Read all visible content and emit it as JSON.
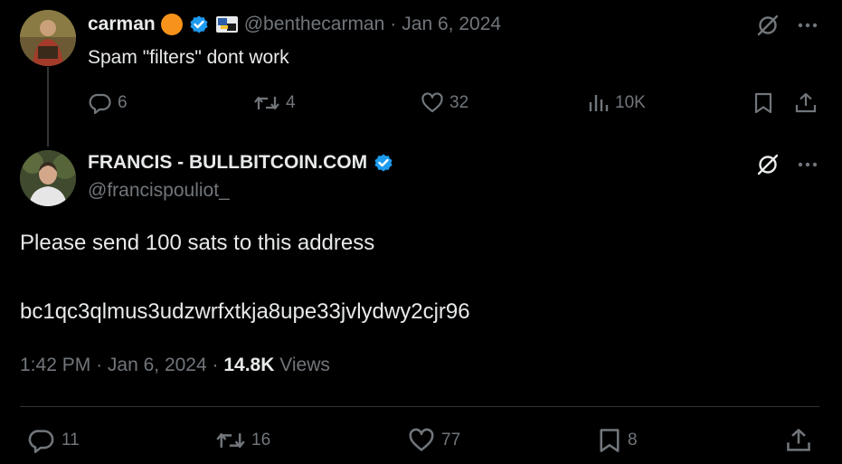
{
  "parent_tweet": {
    "display_name": "carman",
    "handle": "@benthecarman",
    "separator": "·",
    "date": "Jan 6, 2024",
    "text": "Spam \"filters\" dont work",
    "stats": {
      "replies": "6",
      "reposts": "4",
      "likes": "32",
      "views": "10K"
    }
  },
  "main_tweet": {
    "display_name": "FRANCIS - BULLBITCOIN.COM",
    "handle": "@francispouliot_",
    "body_line1": "Please send 100 sats to this address",
    "body_line2": "bc1qc3qlmus3udzwrfxtkja8upe33jvlydwy2cjr96",
    "time": "1:42 PM",
    "separator": "·",
    "date": "Jan 6, 2024",
    "separator2": "·",
    "views_count": "14.8K",
    "views_label": "Views",
    "stats": {
      "replies": "11",
      "reposts": "16",
      "likes": "77",
      "bookmarks": "8"
    }
  },
  "colors": {
    "background": "#000000",
    "text": "#e7e9ea",
    "muted": "#71767b",
    "verified": "#1d9bf0",
    "bitcoin_badge": "#f7931a",
    "divider": "#2f3336"
  },
  "icons": {
    "reply": "reply-icon",
    "repost": "repost-icon",
    "like": "like-icon",
    "views": "views-icon",
    "bookmark": "bookmark-icon",
    "share": "share-icon",
    "grok": "grok-icon",
    "more": "more-icon",
    "verified": "verified-icon"
  }
}
